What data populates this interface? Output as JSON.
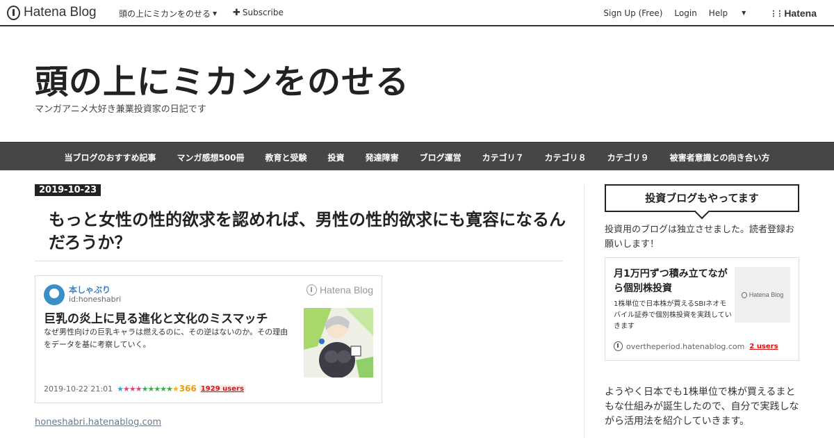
{
  "topbar": {
    "brand": "Hatena Blog",
    "blog_menu": "頭の上にミカンをのせる",
    "subscribe_icon": "✚",
    "subscribe": "Subscribe",
    "sign_up": "Sign Up (Free)",
    "login": "Login",
    "help": "Help",
    "hatena_mark": "Hatena"
  },
  "header": {
    "title": "頭の上にミカンをのせる",
    "description": "マンガアニメ大好き兼業投資家の日記です"
  },
  "nav": {
    "items": [
      "当ブログのおすすめ記事",
      "マンガ感想500冊",
      "教育と受験",
      "投資",
      "発達障害",
      "ブログ運営",
      "カテゴリ７",
      "カテゴリ８",
      "カテゴリ９",
      "被害者意識との向き合い方"
    ]
  },
  "article": {
    "date": "2019-10-23",
    "title": "もっと女性の性的欲求を認めれば、男性の性的欲求にも寛容になるんだろうか？",
    "embed": {
      "author": "本しゃぶり",
      "author_id": "id:honeshabri",
      "brand": "Hatena Blog",
      "title": "巨乳の炎上に見る進化と文化のミスマッチ",
      "description": "なぜ男性向けの巨乳キャラは燃えるのに、その逆はないのか。その理由をデータを基に考察していく。",
      "timestamp": "2019-10-22 21:01",
      "star_count": "366",
      "users": "1929 users"
    },
    "source_link": "honeshabri.hatenablog.com"
  },
  "sidebar": {
    "heading": "投資ブログもやってます",
    "intro": "投資用のブログは独立させました。読者登録お願いします！",
    "card": {
      "title": "月1万円ずつ積み立てながら個別株投資",
      "description": "1株単位で日本株が買えるSBIネオモバイル証券で個別株投資を実践していきます",
      "thumb_label": "Hatena Blog",
      "domain": "overtheperiod.hatenablog.com",
      "users": "2 users"
    },
    "body": "ようやく日本でも1株単位で株が買えるまともな仕組みが誕生したので、自分で実践しながら活用法を紹介していきます。"
  }
}
